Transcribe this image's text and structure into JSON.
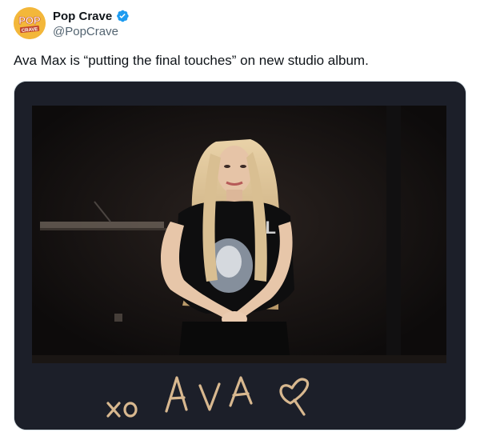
{
  "author": {
    "display_name": "Pop Crave",
    "handle": "@PopCrave",
    "verified": true,
    "avatar_logo_text": [
      "POP",
      "CRAVE"
    ],
    "avatar_color": "#f3b73a",
    "verified_color": "#1d9bf0"
  },
  "tweet": {
    "text": "Ava Max is “putting the final touches” on new studio album."
  },
  "media": {
    "type": "polaroid-photo",
    "handwritten_caption": "xo AVA ♡",
    "frame_color": "#1c1f29",
    "ink_color": "#d8b88f"
  }
}
